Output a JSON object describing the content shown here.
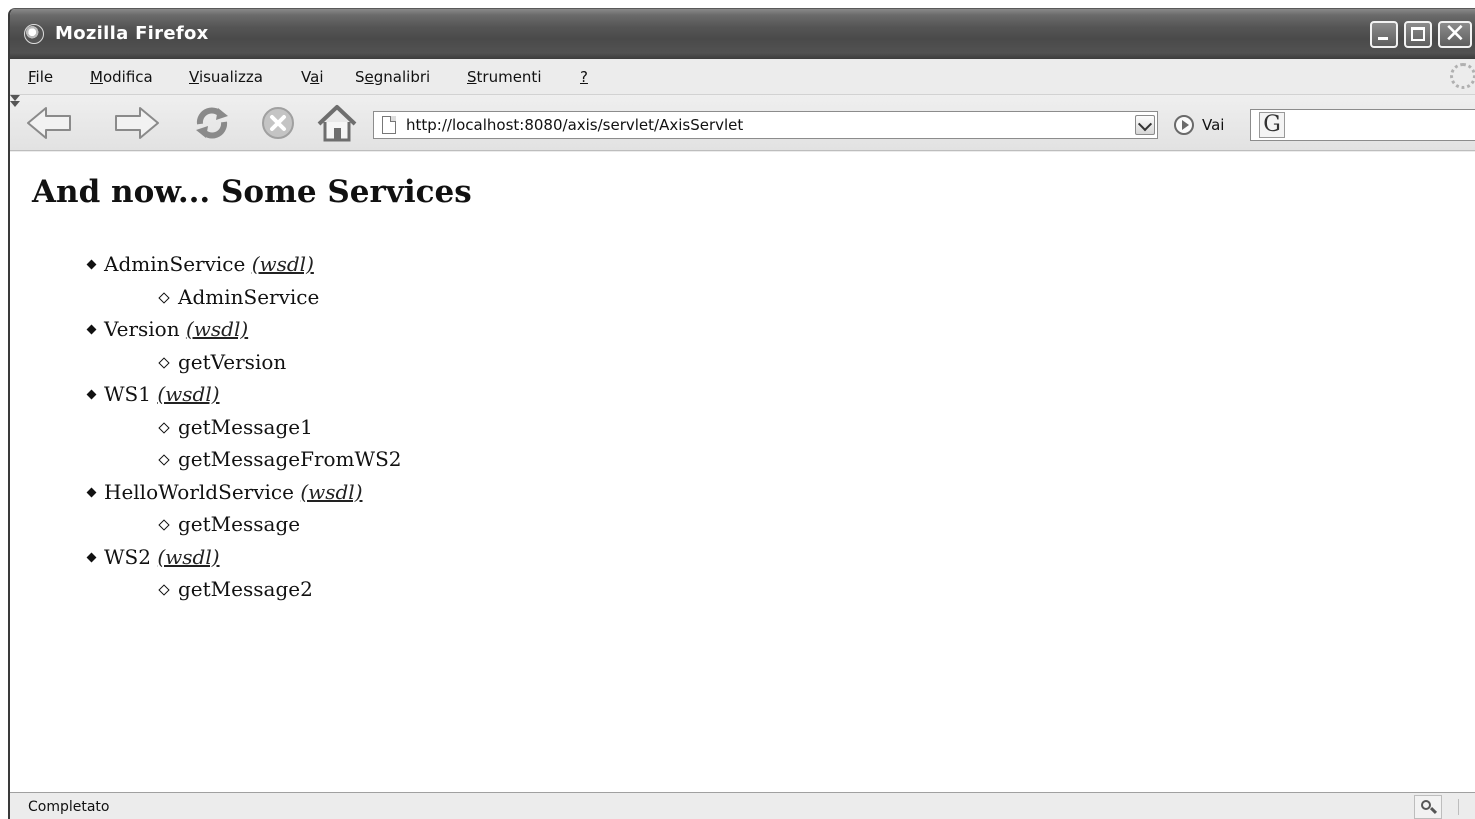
{
  "window": {
    "title": "Mozilla Firefox"
  },
  "menubar": {
    "items": [
      {
        "pre": "",
        "acc": "F",
        "post": "ile"
      },
      {
        "pre": "",
        "acc": "M",
        "post": "odifica"
      },
      {
        "pre": "",
        "acc": "V",
        "post": "isualizza"
      },
      {
        "pre": "V",
        "acc": "a",
        "post": "i"
      },
      {
        "pre": "S",
        "acc": "e",
        "post": "gnalibri"
      },
      {
        "pre": "",
        "acc": "S",
        "post": "trumenti"
      },
      {
        "pre": "",
        "acc": "?",
        "post": ""
      }
    ]
  },
  "toolbar": {
    "url": "http://localhost:8080/axis/servlet/AxisServlet",
    "go_label": "Vai",
    "search_engine": "G"
  },
  "page": {
    "heading": "And now... Some Services",
    "wsdl_label": "(wsdl)",
    "services": [
      {
        "name": "AdminService",
        "methods": [
          "AdminService"
        ]
      },
      {
        "name": "Version",
        "methods": [
          "getVersion"
        ]
      },
      {
        "name": "WS1",
        "methods": [
          "getMessage1",
          "getMessageFromWS2"
        ]
      },
      {
        "name": "HelloWorldService",
        "methods": [
          "getMessage"
        ]
      },
      {
        "name": "WS2",
        "methods": [
          "getMessage2"
        ]
      }
    ]
  },
  "statusbar": {
    "text": "Completato"
  },
  "colors": {
    "titlebar": "#4a4a4a",
    "chrome": "#ececec",
    "content_bg": "#ffffff"
  },
  "icons": [
    "firefox-icon",
    "minimize-icon",
    "maximize-icon",
    "close-icon",
    "back-arrow-icon",
    "forward-arrow-icon",
    "reload-icon",
    "stop-icon",
    "home-icon",
    "page-icon",
    "dropdown-arrow-icon",
    "go-icon",
    "google-search-icon",
    "throbber-icon",
    "zoom-icon"
  ]
}
